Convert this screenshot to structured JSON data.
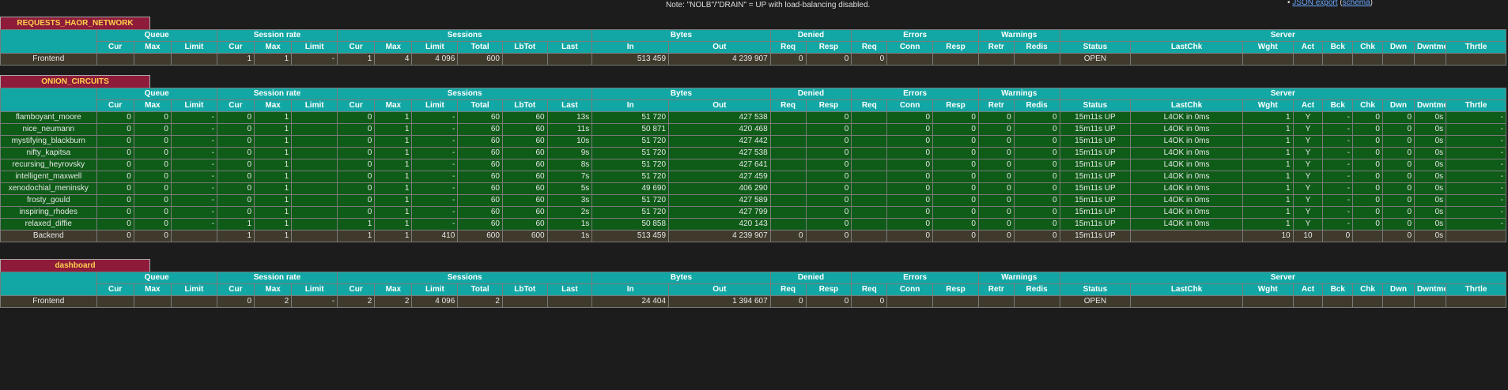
{
  "top": {
    "note": "Note: \"NOLB\"/\"DRAIN\" = UP with load-balancing disabled.",
    "json_export": "JSON export",
    "schema": "schema"
  },
  "groups": [
    "Queue",
    "Session rate",
    "Sessions",
    "Bytes",
    "Denied",
    "Errors",
    "Warnings",
    "Server"
  ],
  "cols": [
    "Cur",
    "Max",
    "Limit",
    "Cur",
    "Max",
    "Limit",
    "Cur",
    "Max",
    "Limit",
    "Total",
    "LbTot",
    "Last",
    "In",
    "Out",
    "Req",
    "Resp",
    "Req",
    "Conn",
    "Resp",
    "Retr",
    "Redis",
    "Status",
    "LastChk",
    "Wght",
    "Act",
    "Bck",
    "Chk",
    "Dwn",
    "Dwntme",
    "Thrtle"
  ],
  "proxies": [
    {
      "name": "REQUESTS_HAOR_NETWORK",
      "rows": [
        {
          "type": "frontend",
          "cells": [
            "Frontend",
            "",
            "",
            "",
            "1",
            "1",
            "-",
            "1",
            "4",
            "4 096",
            "600",
            "",
            "",
            "513 459",
            "4 239 907",
            "0",
            "0",
            "0",
            "",
            "",
            "",
            "",
            "OPEN",
            "",
            "",
            "",
            "",
            "",
            "",
            "",
            ""
          ]
        }
      ]
    },
    {
      "name": "ONION_CIRCUITS",
      "rows": [
        {
          "type": "server",
          "cells": [
            "flamboyant_moore",
            "0",
            "0",
            "-",
            "0",
            "1",
            "",
            "0",
            "1",
            "-",
            "60",
            "60",
            "13s",
            "51 720",
            "427 538",
            "",
            "0",
            "",
            "0",
            "0",
            "0",
            "0",
            "15m11s UP",
            "L4OK in 0ms",
            "1",
            "Y",
            "-",
            "0",
            "0",
            "0s",
            "-"
          ]
        },
        {
          "type": "server",
          "cells": [
            "nice_neumann",
            "0",
            "0",
            "-",
            "0",
            "1",
            "",
            "0",
            "1",
            "-",
            "60",
            "60",
            "11s",
            "50 871",
            "420 468",
            "",
            "0",
            "",
            "0",
            "0",
            "0",
            "0",
            "15m11s UP",
            "L4OK in 0ms",
            "1",
            "Y",
            "-",
            "0",
            "0",
            "0s",
            "-"
          ]
        },
        {
          "type": "server",
          "cells": [
            "mystifying_blackburn",
            "0",
            "0",
            "-",
            "0",
            "1",
            "",
            "0",
            "1",
            "-",
            "60",
            "60",
            "10s",
            "51 720",
            "427 442",
            "",
            "0",
            "",
            "0",
            "0",
            "0",
            "0",
            "15m11s UP",
            "L4OK in 0ms",
            "1",
            "Y",
            "-",
            "0",
            "0",
            "0s",
            "-"
          ]
        },
        {
          "type": "server",
          "cells": [
            "nifty_kapitsa",
            "0",
            "0",
            "-",
            "0",
            "1",
            "",
            "0",
            "1",
            "-",
            "60",
            "60",
            "9s",
            "51 720",
            "427 538",
            "",
            "0",
            "",
            "0",
            "0",
            "0",
            "0",
            "15m11s UP",
            "L4OK in 0ms",
            "1",
            "Y",
            "-",
            "0",
            "0",
            "0s",
            "-"
          ]
        },
        {
          "type": "server",
          "cells": [
            "recursing_heyrovsky",
            "0",
            "0",
            "-",
            "0",
            "1",
            "",
            "0",
            "1",
            "-",
            "60",
            "60",
            "8s",
            "51 720",
            "427 641",
            "",
            "0",
            "",
            "0",
            "0",
            "0",
            "0",
            "15m11s UP",
            "L4OK in 0ms",
            "1",
            "Y",
            "-",
            "0",
            "0",
            "0s",
            "-"
          ]
        },
        {
          "type": "server",
          "cells": [
            "intelligent_maxwell",
            "0",
            "0",
            "-",
            "0",
            "1",
            "",
            "0",
            "1",
            "-",
            "60",
            "60",
            "7s",
            "51 720",
            "427 459",
            "",
            "0",
            "",
            "0",
            "0",
            "0",
            "0",
            "15m11s UP",
            "L4OK in 0ms",
            "1",
            "Y",
            "-",
            "0",
            "0",
            "0s",
            "-"
          ]
        },
        {
          "type": "server",
          "cells": [
            "xenodochial_meninsky",
            "0",
            "0",
            "-",
            "0",
            "1",
            "",
            "0",
            "1",
            "-",
            "60",
            "60",
            "5s",
            "49 690",
            "406 290",
            "",
            "0",
            "",
            "0",
            "0",
            "0",
            "0",
            "15m11s UP",
            "L4OK in 0ms",
            "1",
            "Y",
            "-",
            "0",
            "0",
            "0s",
            "-"
          ]
        },
        {
          "type": "server",
          "cells": [
            "frosty_gould",
            "0",
            "0",
            "-",
            "0",
            "1",
            "",
            "0",
            "1",
            "-",
            "60",
            "60",
            "3s",
            "51 720",
            "427 589",
            "",
            "0",
            "",
            "0",
            "0",
            "0",
            "0",
            "15m11s UP",
            "L4OK in 0ms",
            "1",
            "Y",
            "-",
            "0",
            "0",
            "0s",
            "-"
          ]
        },
        {
          "type": "server",
          "cells": [
            "inspiring_rhodes",
            "0",
            "0",
            "-",
            "0",
            "1",
            "",
            "0",
            "1",
            "-",
            "60",
            "60",
            "2s",
            "51 720",
            "427 799",
            "",
            "0",
            "",
            "0",
            "0",
            "0",
            "0",
            "15m11s UP",
            "L4OK in 0ms",
            "1",
            "Y",
            "-",
            "0",
            "0",
            "0s",
            "-"
          ]
        },
        {
          "type": "server",
          "cells": [
            "relaxed_diffie",
            "0",
            "0",
            "-",
            "1",
            "1",
            "",
            "1",
            "1",
            "-",
            "60",
            "60",
            "1s",
            "50 858",
            "420 143",
            "",
            "0",
            "",
            "0",
            "0",
            "0",
            "0",
            "15m11s UP",
            "L4OK in 0ms",
            "1",
            "Y",
            "-",
            "0",
            "0",
            "0s",
            "-"
          ]
        },
        {
          "type": "backend",
          "cells": [
            "Backend",
            "0",
            "0",
            "",
            "1",
            "1",
            "",
            "1",
            "1",
            "410",
            "600",
            "600",
            "1s",
            "513 459",
            "4 239 907",
            "0",
            "0",
            "",
            "0",
            "0",
            "0",
            "0",
            "15m11s UP",
            "",
            "10",
            "10",
            "0",
            "",
            "0",
            "0s",
            ""
          ]
        }
      ]
    },
    {
      "name": "dashboard",
      "rows": [
        {
          "type": "frontend",
          "cells": [
            "Frontend",
            "",
            "",
            "",
            "0",
            "2",
            "-",
            "2",
            "2",
            "4 096",
            "2",
            "",
            "",
            "24 404",
            "1 394 607",
            "0",
            "0",
            "0",
            "",
            "",
            "",
            "",
            "OPEN",
            "",
            "",
            "",
            "",
            "",
            "",
            "",
            ""
          ]
        }
      ]
    }
  ]
}
